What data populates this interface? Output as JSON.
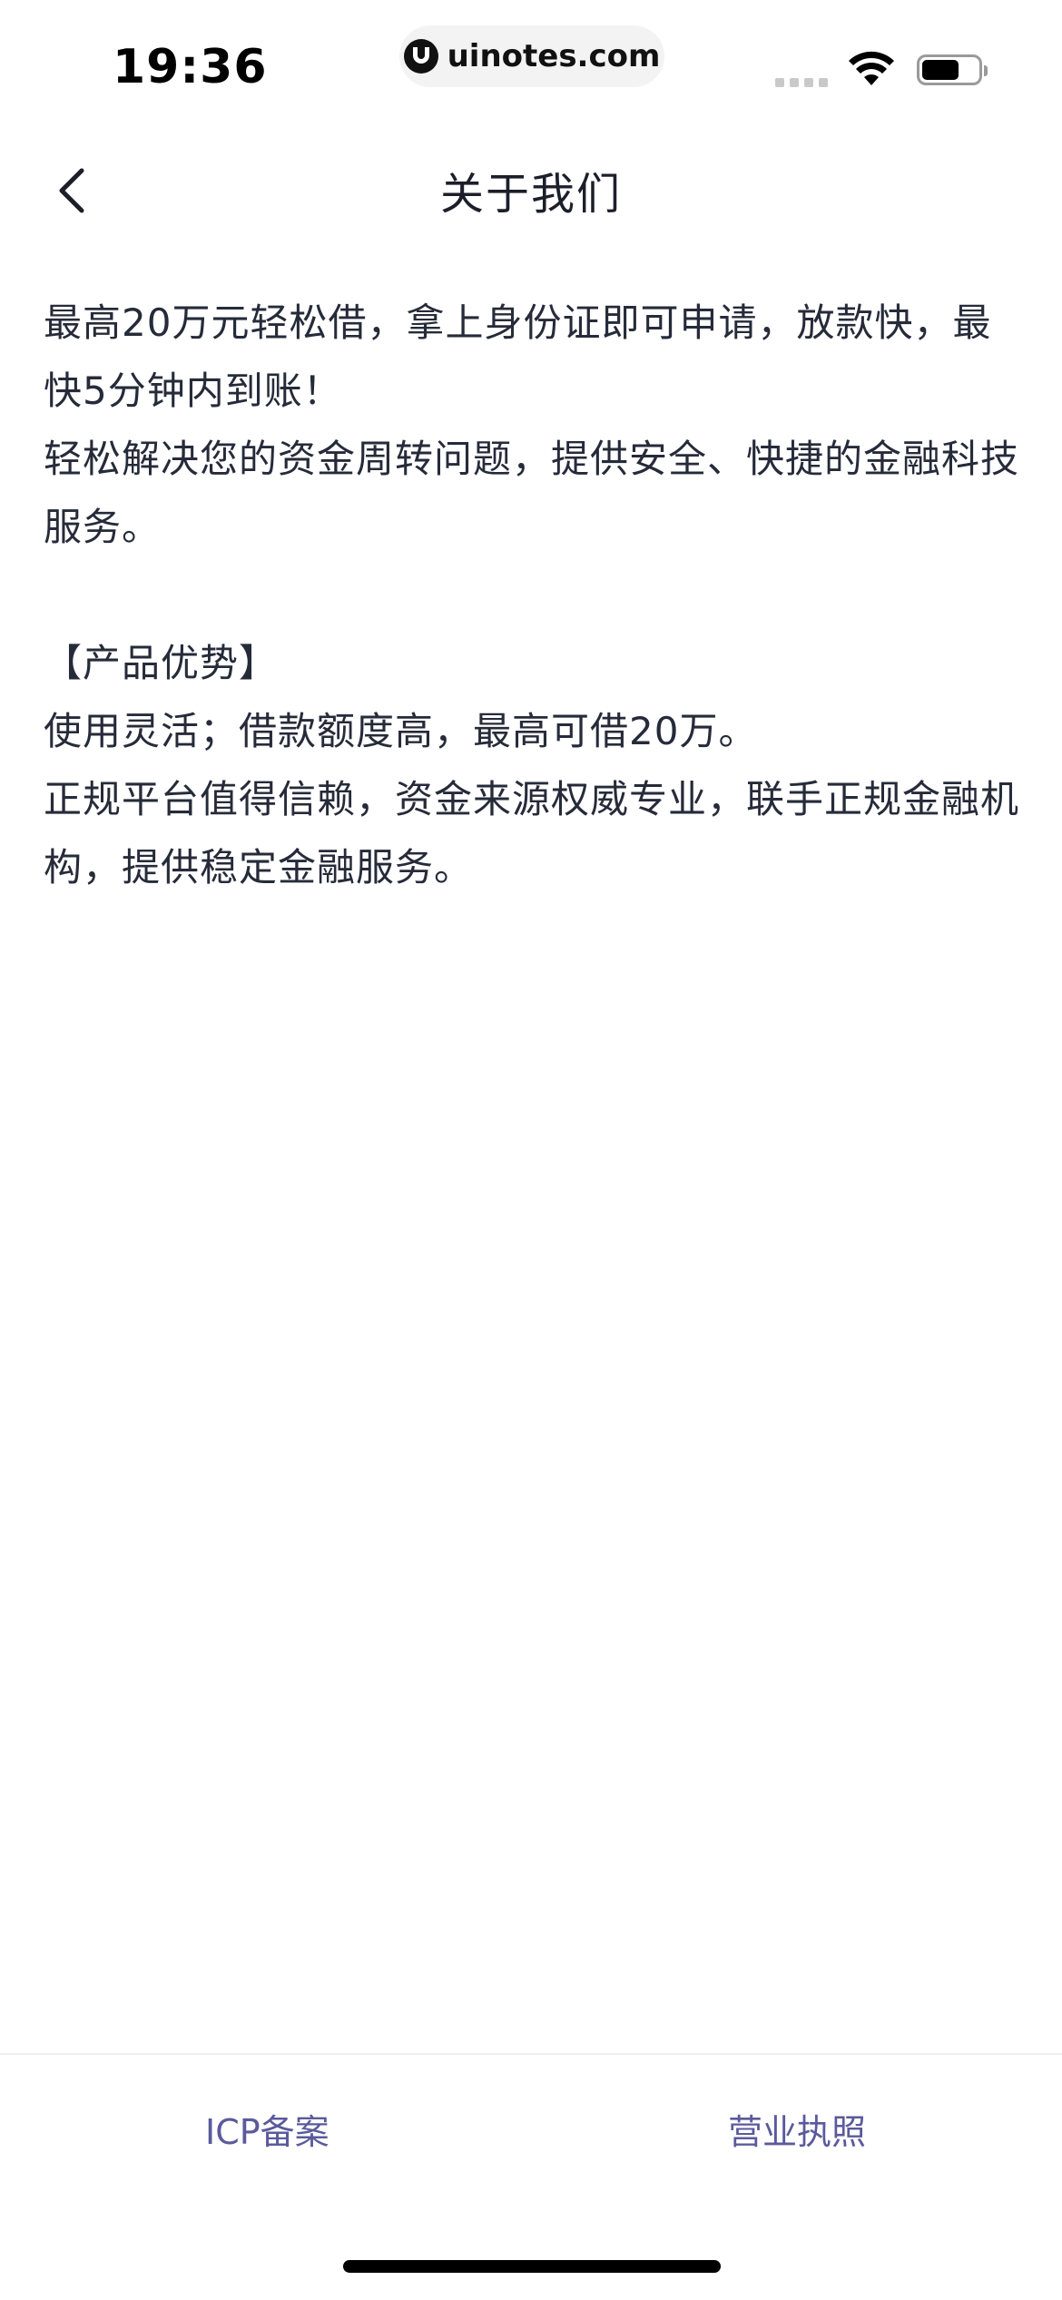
{
  "status_bar": {
    "time": "19:36",
    "url": "uinotes.com"
  },
  "nav": {
    "title": "关于我们"
  },
  "content": {
    "paragraphs": [
      "最高20万元轻松借，拿上身份证即可申请，放款快，最快5分钟内到账！",
      "轻松解决您的资金周转问题，提供安全、快捷的金融科技服务。",
      "【产品优势】",
      "使用灵活；借款额度高，最高可借20万。",
      "正规平台值得信赖，资金来源权威专业，联手正规金融机构，提供稳定金融服务。"
    ]
  },
  "footer": {
    "icp_label": "ICP备案",
    "license_label": "营业执照"
  },
  "colors": {
    "text": "#262b3a",
    "link": "#5a5a9c"
  },
  "icons": {
    "back": "chevron-left-icon",
    "wifi": "wifi-icon",
    "battery": "battery-icon"
  }
}
